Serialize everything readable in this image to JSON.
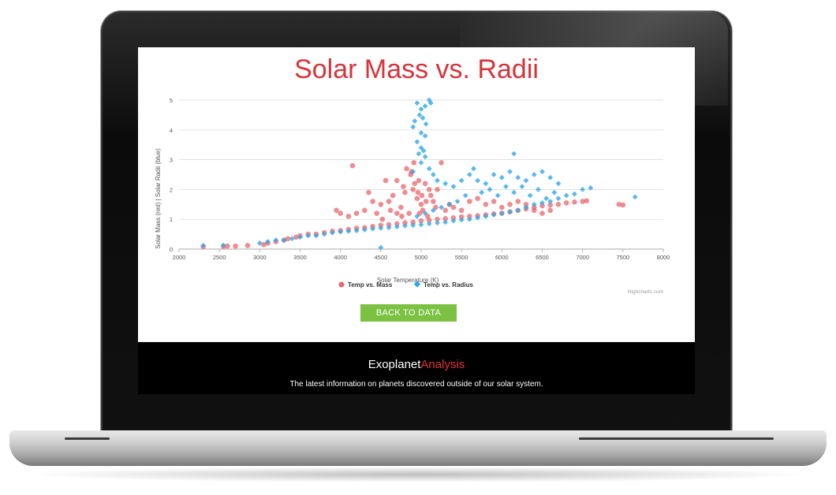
{
  "page": {
    "title": "Solar Mass vs. Radii",
    "button_label": "BACK TO DATA",
    "footer": {
      "brand_main": "Exoplanet",
      "brand_accent": "Analysis",
      "tagline": "The latest information on planets discovered outside of our solar system."
    },
    "credits": "Highcharts.com"
  },
  "colors": {
    "title": "#d8333a",
    "mass_series": "#e8666d",
    "radius_series": "#2fa8e6",
    "button": "#7cc242",
    "footer_bg": "#000000",
    "brand_accent": "#e0313b"
  },
  "chart_data": {
    "type": "scatter",
    "title": "Solar Mass vs. Radii",
    "xlabel": "Solar Temperature (K)",
    "ylabel": "Solar Mass (red) | Solar Radii (blue)",
    "xlim": [
      2000,
      8000
    ],
    "ylim": [
      0,
      5
    ],
    "x_ticks": [
      2000,
      2500,
      3000,
      3500,
      4000,
      4500,
      5000,
      5500,
      6000,
      6500,
      7000,
      7500,
      8000
    ],
    "y_ticks": [
      0,
      1,
      2,
      3,
      4,
      5
    ],
    "grid": true,
    "legend": "bottom-center",
    "series": [
      {
        "name": "Temp vs. Mass",
        "marker": "circle",
        "points": [
          [
            2300,
            0.08
          ],
          [
            2550,
            0.09
          ],
          [
            2600,
            0.1
          ],
          [
            2700,
            0.1
          ],
          [
            2850,
            0.12
          ],
          [
            3050,
            0.15
          ],
          [
            3100,
            0.2
          ],
          [
            3200,
            0.25
          ],
          [
            3300,
            0.3
          ],
          [
            3350,
            0.35
          ],
          [
            3450,
            0.4
          ],
          [
            3500,
            0.45
          ],
          [
            3600,
            0.5
          ],
          [
            3700,
            0.5
          ],
          [
            3800,
            0.55
          ],
          [
            3900,
            0.6
          ],
          [
            4000,
            0.62
          ],
          [
            4100,
            0.66
          ],
          [
            4200,
            0.7
          ],
          [
            4300,
            0.72
          ],
          [
            4400,
            0.76
          ],
          [
            4500,
            0.8
          ],
          [
            4600,
            0.82
          ],
          [
            4700,
            0.85
          ],
          [
            4800,
            0.88
          ],
          [
            4900,
            0.9
          ],
          [
            5000,
            0.95
          ],
          [
            5100,
            0.97
          ],
          [
            5200,
            1.0
          ],
          [
            5300,
            1.02
          ],
          [
            5400,
            1.05
          ],
          [
            5500,
            1.08
          ],
          [
            5600,
            1.1
          ],
          [
            5700,
            1.12
          ],
          [
            5800,
            1.15
          ],
          [
            5900,
            1.18
          ],
          [
            6000,
            1.2
          ],
          [
            6100,
            1.25
          ],
          [
            6200,
            1.3
          ],
          [
            6300,
            1.35
          ],
          [
            6400,
            1.4
          ],
          [
            6500,
            1.45
          ],
          [
            6600,
            1.48
          ],
          [
            6700,
            1.5
          ],
          [
            6800,
            1.55
          ],
          [
            6900,
            1.58
          ],
          [
            7000,
            1.6
          ],
          [
            7050,
            1.62
          ],
          [
            7450,
            1.5
          ],
          [
            7500,
            1.48
          ],
          [
            4150,
            2.8
          ],
          [
            4350,
            1.9
          ],
          [
            4400,
            1.6
          ],
          [
            4300,
            1.3
          ],
          [
            4200,
            1.2
          ],
          [
            4100,
            1.1
          ],
          [
            4000,
            1.2
          ],
          [
            3950,
            1.3
          ],
          [
            4500,
            1.5
          ],
          [
            4600,
            1.6
          ],
          [
            4650,
            1.8
          ],
          [
            4700,
            2.3
          ],
          [
            4750,
            1.4
          ],
          [
            4800,
            1.9
          ],
          [
            4850,
            1.2
          ],
          [
            4900,
            2.0
          ],
          [
            4950,
            1.7
          ],
          [
            4880,
            2.6
          ],
          [
            4920,
            2.2
          ],
          [
            4960,
            1.9
          ],
          [
            5000,
            1.5
          ],
          [
            5050,
            2.2
          ],
          [
            5100,
            2.0
          ],
          [
            5150,
            1.6
          ],
          [
            5200,
            2.0
          ],
          [
            5250,
            2.9
          ],
          [
            5300,
            1.3
          ],
          [
            4780,
            2.1
          ],
          [
            4820,
            2.7
          ],
          [
            4870,
            2.5
          ],
          [
            4910,
            2.9
          ],
          [
            4970,
            2.3
          ],
          [
            5010,
            1.8
          ],
          [
            5060,
            1.6
          ],
          [
            5120,
            1.8
          ],
          [
            5180,
            1.4
          ],
          [
            4980,
            1.2
          ],
          [
            5020,
            1.3
          ],
          [
            5080,
            1.1
          ],
          [
            4560,
            2.3
          ],
          [
            4620,
            1.3
          ],
          [
            4700,
            1.2
          ],
          [
            4760,
            1.1
          ],
          [
            4520,
            1.0
          ],
          [
            4450,
            1.2
          ],
          [
            5350,
            1.5
          ],
          [
            5400,
            1.4
          ],
          [
            5500,
            1.3
          ],
          [
            5600,
            1.6
          ],
          [
            5700,
            1.7
          ],
          [
            5800,
            1.5
          ],
          [
            5900,
            1.6
          ],
          [
            6000,
            1.4
          ],
          [
            6100,
            1.5
          ],
          [
            6200,
            1.6
          ],
          [
            6300,
            1.5
          ],
          [
            6400,
            1.3
          ],
          [
            6500,
            1.2
          ],
          [
            6600,
            1.3
          ]
        ]
      },
      {
        "name": "Temp vs. Radius",
        "marker": "diamond",
        "points": [
          [
            2300,
            0.12
          ],
          [
            2550,
            0.13
          ],
          [
            3000,
            0.2
          ],
          [
            3100,
            0.25
          ],
          [
            3200,
            0.3
          ],
          [
            3300,
            0.3
          ],
          [
            3400,
            0.35
          ],
          [
            3500,
            0.4
          ],
          [
            3600,
            0.45
          ],
          [
            3700,
            0.45
          ],
          [
            3800,
            0.5
          ],
          [
            3900,
            0.55
          ],
          [
            4000,
            0.58
          ],
          [
            4100,
            0.6
          ],
          [
            4200,
            0.62
          ],
          [
            4300,
            0.65
          ],
          [
            4400,
            0.68
          ],
          [
            4500,
            0.7
          ],
          [
            4600,
            0.72
          ],
          [
            4700,
            0.75
          ],
          [
            4800,
            0.78
          ],
          [
            4900,
            0.8
          ],
          [
            5000,
            0.82
          ],
          [
            5100,
            0.85
          ],
          [
            5200,
            0.88
          ],
          [
            5300,
            0.9
          ],
          [
            5400,
            0.95
          ],
          [
            5500,
            0.98
          ],
          [
            5600,
            1.0
          ],
          [
            5700,
            1.05
          ],
          [
            5800,
            1.1
          ],
          [
            5900,
            1.15
          ],
          [
            6000,
            1.2
          ],
          [
            6100,
            1.25
          ],
          [
            6200,
            1.3
          ],
          [
            6300,
            1.4
          ],
          [
            6400,
            1.5
          ],
          [
            6500,
            1.55
          ],
          [
            6600,
            1.6
          ],
          [
            6700,
            1.7
          ],
          [
            6800,
            1.8
          ],
          [
            6900,
            1.85
          ],
          [
            7000,
            2.0
          ],
          [
            7100,
            2.05
          ],
          [
            7650,
            1.75
          ],
          [
            4500,
            0.05
          ],
          [
            4950,
            4.9
          ],
          [
            5000,
            4.7
          ],
          [
            5050,
            4.8
          ],
          [
            5100,
            5.0
          ],
          [
            5120,
            4.9
          ],
          [
            4980,
            4.5
          ],
          [
            5020,
            4.4
          ],
          [
            5060,
            4.2
          ],
          [
            4920,
            4.3
          ],
          [
            4900,
            4.1
          ],
          [
            5000,
            3.9
          ],
          [
            5050,
            3.8
          ],
          [
            4950,
            3.6
          ],
          [
            5000,
            3.4
          ],
          [
            5030,
            3.3
          ],
          [
            4970,
            3.2
          ],
          [
            5050,
            3.1
          ],
          [
            5000,
            2.9
          ],
          [
            5100,
            2.7
          ],
          [
            4900,
            2.6
          ],
          [
            5150,
            2.5
          ],
          [
            5200,
            2.3
          ],
          [
            5300,
            2.2
          ],
          [
            5400,
            2.1
          ],
          [
            5500,
            2.3
          ],
          [
            5600,
            2.5
          ],
          [
            5700,
            2.3
          ],
          [
            5800,
            2.2
          ],
          [
            5900,
            2.5
          ],
          [
            6000,
            2.4
          ],
          [
            6100,
            2.6
          ],
          [
            6150,
            3.2
          ],
          [
            6200,
            2.4
          ],
          [
            6300,
            2.3
          ],
          [
            6400,
            2.5
          ],
          [
            6500,
            2.6
          ],
          [
            6600,
            2.4
          ],
          [
            6700,
            2.2
          ],
          [
            5650,
            2.7
          ],
          [
            5850,
            2.0
          ],
          [
            6050,
            2.1
          ],
          [
            6250,
            2.1
          ],
          [
            6450,
            2.0
          ],
          [
            6650,
            1.9
          ],
          [
            5750,
            1.9
          ],
          [
            5950,
            1.8
          ],
          [
            6150,
            1.9
          ],
          [
            6350,
            1.8
          ],
          [
            6550,
            1.7
          ],
          [
            5550,
            1.8
          ],
          [
            5450,
            1.6
          ],
          [
            5350,
            1.5
          ],
          [
            5250,
            1.4
          ],
          [
            5150,
            1.3
          ],
          [
            5050,
            1.2
          ],
          [
            4950,
            1.1
          ]
        ]
      }
    ]
  }
}
